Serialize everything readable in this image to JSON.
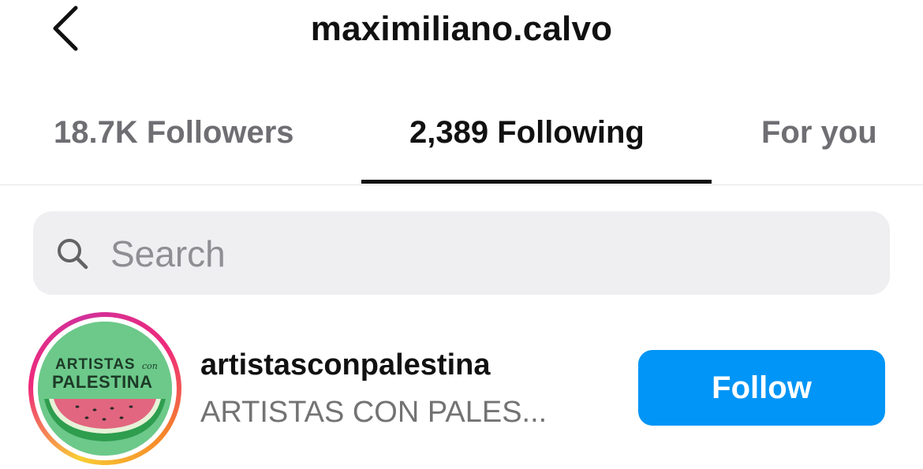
{
  "header": {
    "back_icon": "chevron-left-icon",
    "title": "maximiliano.calvo"
  },
  "tabs": [
    {
      "label": "18.7K Followers",
      "active": false
    },
    {
      "label": "2,389 Following",
      "active": true
    },
    {
      "label": "For you",
      "active": false
    }
  ],
  "search": {
    "icon": "search-icon",
    "placeholder": "Search",
    "value": ""
  },
  "list": [
    {
      "username": "artistasconpalestina",
      "full_name": "ARTISTAS CON PALES...",
      "avatar_text": {
        "line1": "ARTISTAS",
        "small": "con",
        "line2": "PALESTINA"
      },
      "button_label": "Follow",
      "has_story_ring": true
    }
  ],
  "colors": {
    "accent": "#0095f6",
    "text_primary": "#111111",
    "text_secondary": "#737373",
    "search_bg": "#efeff1"
  }
}
